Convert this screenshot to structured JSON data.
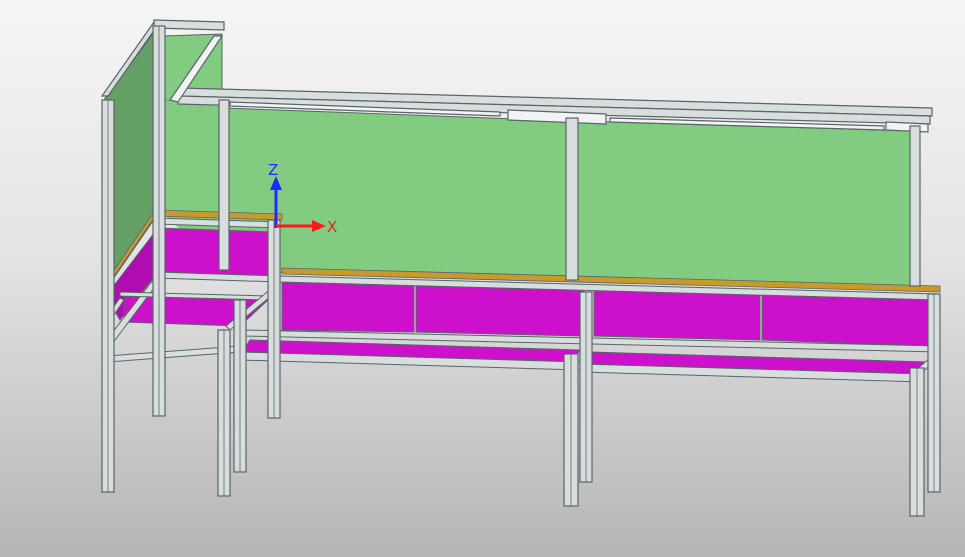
{
  "viewport": {
    "background_top": "#f5f5f5",
    "background_bottom": "#b5b5b5"
  },
  "model": {
    "panel_color": "#82cc82",
    "side_panel_color": "#64a064",
    "drawer_color": "#cc10cc",
    "worktop_edge_color": "#c89a2c",
    "frame_color": "#5a6468",
    "frame_highlight": "#e8eeee"
  },
  "axis_triad": {
    "z_label": "Z",
    "x_label": "X",
    "z_color": "#1a2cff",
    "x_color": "#ff1a1a"
  }
}
